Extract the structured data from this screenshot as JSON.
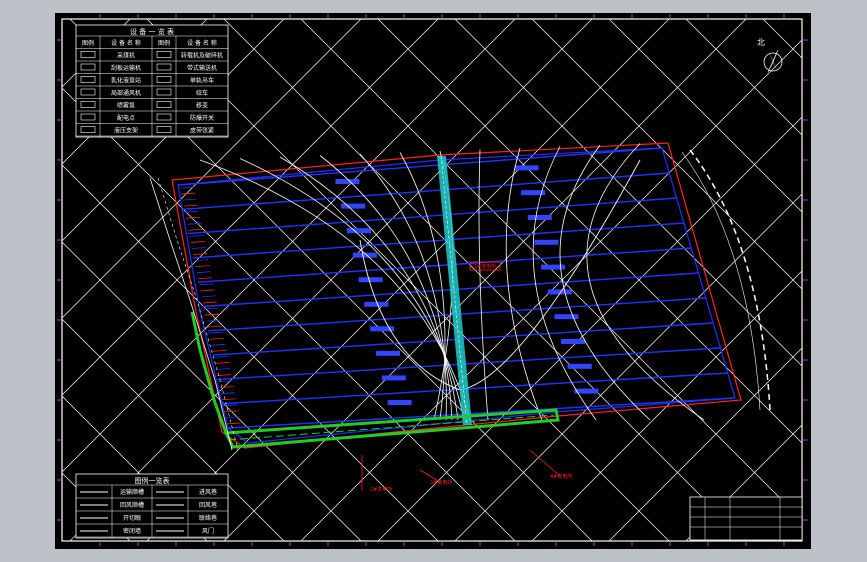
{
  "legend_top": {
    "title": "设 备 一 览 表",
    "header": [
      "图例",
      "设 备 名 称",
      "图例",
      "设 备 名 称"
    ],
    "rows": [
      [
        "",
        "采煤机",
        "",
        "转载机及破碎机"
      ],
      [
        "",
        "刮板运输机",
        "",
        "带式输送机"
      ],
      [
        "",
        "乳化液泵站",
        "",
        "单轨吊车"
      ],
      [
        "",
        "局部通风机",
        "",
        "绞车"
      ],
      [
        "",
        "喷雾泵",
        "",
        "移变"
      ],
      [
        "",
        "配电点",
        "",
        "防爆开关"
      ],
      [
        "",
        "液压支架",
        "",
        "皮带张紧"
      ]
    ]
  },
  "legend_bottom": {
    "title": "图例一览表",
    "rows": [
      [
        "",
        "运输顺槽",
        "",
        "进风巷"
      ],
      [
        "",
        "回风顺槽",
        "",
        "回风巷"
      ],
      [
        "",
        "开切眼",
        "",
        "联络巷"
      ],
      [
        "",
        "密闭墙",
        "",
        "风门"
      ]
    ]
  },
  "colors": {
    "background": "#000000",
    "frame": "#ffffff",
    "grid": "#ffffff",
    "panel": "#1f2fff",
    "boundary": "#ff2020",
    "belt": "#20ffff",
    "roadway": "#22cc22",
    "annotation": "#ff33ff"
  },
  "drawing": {
    "north_label": "北",
    "red_labels": [
      "1#变电所",
      "2#变电所",
      "3#变电所",
      "4#变电所"
    ]
  }
}
